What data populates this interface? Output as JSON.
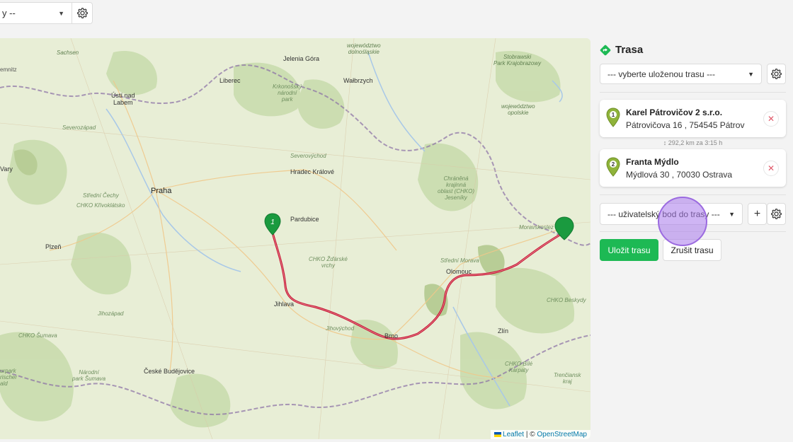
{
  "toolbar": {
    "select_value": "y --",
    "settings_icon": "gear-icon"
  },
  "map": {
    "attribution_leaflet": "Leaflet",
    "attribution_sep": " | © ",
    "attribution_osm": "OpenStreetMap",
    "markers": {
      "start_label": "1"
    },
    "labels": {
      "sachsen": "Sachsen",
      "chemnitz": "emnitz",
      "jelenia": "Jelenia Góra",
      "woj_dolno": "województwo\ndolnośląskie",
      "walbrzych": "Wałbrzych",
      "liberec": "Liberec",
      "krkonossky": "Krkonošský\nnárodní\npark",
      "usti": "Ústí nad\nLabem",
      "severozapad": "Severozápad",
      "vary": "Vary",
      "severovychod": "Severovýchod",
      "hradec": "Hradec Králové",
      "pardubice": "Pardubice",
      "praha": "Praha",
      "stredni_cechy": "Střední Čechy",
      "chko_krivoklatsko": "CHKO Křivoklátsko",
      "plzen": "Plzeň",
      "chko_zdarske": "CHKO Žďárské\nvrchy",
      "jihlava": "Jihlava",
      "jihozapad": "Jihozápad",
      "jihovychod": "Jihovýchod",
      "brno": "Brno",
      "olomouc": "Olomouc",
      "stredni_morava": "Střední Morava",
      "zlin": "Zlín",
      "chko_sumava": "CHKO Šumava",
      "narodni_sumava": "Národní\npark Šumava",
      "ceske_budejovice": "České Budějovice",
      "urpark": "urpark\nrischer\nald",
      "chranena": "Chráněná\nkrajinná\noblast (CHKO)\nJeseníky",
      "moravskoslezsko": "Moravskoslez",
      "chko_beskydy": "CHKO Beskydy",
      "chko_bile": "CHKO Bílé\nKarpaty",
      "trenciansky": "Trenčiansk\nkraj",
      "stobrawski": "Stobrawski\nPark Krajobrazowy",
      "woj_opolskie": "województwo\nopolskie"
    }
  },
  "sidebar": {
    "title": "Trasa",
    "route_select_placeholder": "--- vyberte uloženou trasu ---",
    "stops": [
      {
        "index": "1",
        "name": "Karel Pátrovičov 2 s.r.o.",
        "address": "Pátrovičova 16 , 754545 Pátrov"
      },
      {
        "index": "2",
        "name": "Franta Mýdlo",
        "address": "Mýdlová 30 , 70030 Ostrava"
      }
    ],
    "distance": "↕ 292,2 km za 3:15 h",
    "point_select_placeholder": "--- uživatelský bod do trasy ---",
    "save_label": "Uložit trasu",
    "cancel_label": "Zrušit trasu"
  },
  "colors": {
    "accent_green": "#1db954",
    "route_red": "#c8102e",
    "marker_green": "#1a9a3f",
    "click_indicator": "#a878eb"
  }
}
